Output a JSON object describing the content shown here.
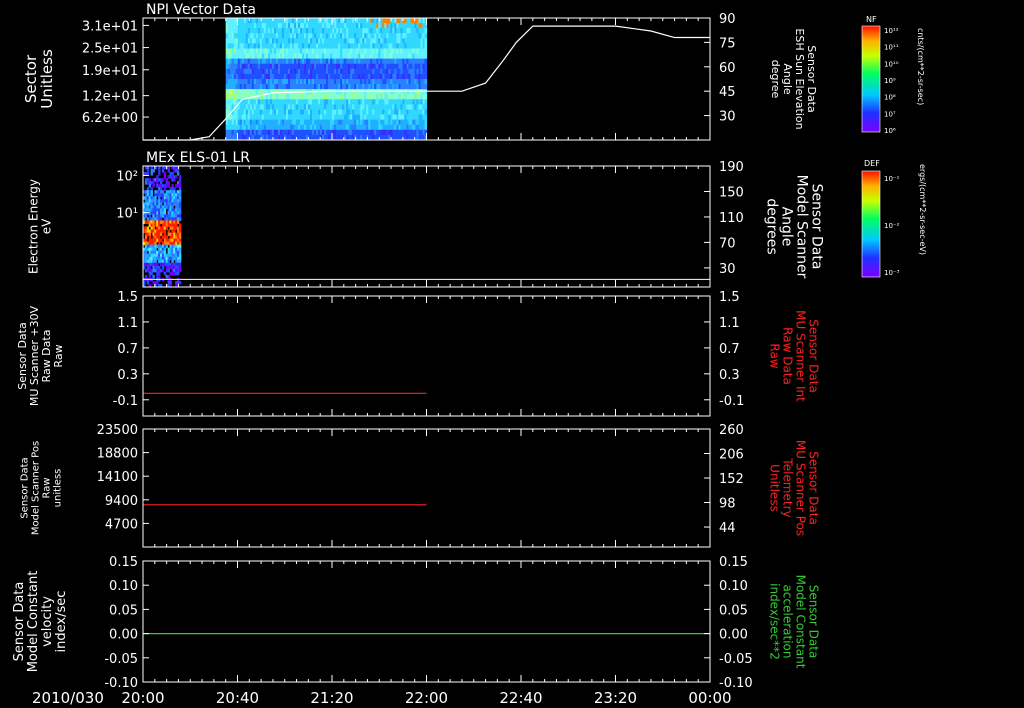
{
  "colors": {
    "background": "#000000",
    "axis": "#ffffff",
    "red_trace": "#ff2020",
    "green_trace": "#33cc33"
  },
  "time_axis": {
    "date_label": "2010/030",
    "start": "20:00",
    "end": "00:00",
    "tick_labels": [
      "20:00",
      "20:40",
      "21:20",
      "22:00",
      "22:40",
      "23:20",
      "00:00"
    ],
    "tick_minutes": [
      0,
      40,
      80,
      120,
      160,
      200,
      240
    ],
    "minor_tick_step_minutes": 5,
    "total_minutes": 240
  },
  "chart_data": [
    {
      "type": "heatmap",
      "title": "NPI Vector Data",
      "ylabel": [
        "Sector",
        "Unitless"
      ],
      "y_ticks": [
        "3.1e+01",
        "2.5e+01",
        "1.9e+01",
        "1.2e+01",
        "6.2e+00"
      ],
      "y_tick_values": [
        31,
        25,
        19,
        12,
        6.2
      ],
      "ylim": [
        0,
        33
      ],
      "data_extent_minutes": [
        35,
        120
      ],
      "colorbar": {
        "label": "NF",
        "units": "cnts/(cm**2-sr-sec)",
        "tick_labels": [
          "10¹²",
          "10¹¹",
          "10¹⁰",
          "10⁹",
          "10⁸",
          "10⁷",
          "10⁶"
        ]
      },
      "right_axis": {
        "label": [
          "Sensor Data",
          "ESH Sun Elevation",
          "Angle",
          "degree"
        ],
        "ticks": [
          "90",
          "75",
          "60",
          "45",
          "30"
        ],
        "tick_values": [
          90,
          75,
          60,
          45,
          30
        ],
        "ylim": [
          15,
          90
        ]
      },
      "overlay": {
        "name": "ESH Sun Elevation Angle",
        "x_minutes": [
          0,
          20,
          28,
          35,
          42,
          55,
          80,
          110,
          135,
          145,
          152,
          158,
          165,
          200,
          215,
          225,
          240
        ],
        "y": [
          15,
          15,
          17,
          28,
          40,
          44,
          45,
          45,
          45,
          50,
          63,
          75,
          85,
          85,
          82,
          78,
          78
        ]
      }
    },
    {
      "type": "heatmap",
      "title": "MEx ELS-01 LR",
      "ylabel": [
        "Electron Energy",
        "eV"
      ],
      "y_ticks": [
        "10²",
        "10¹"
      ],
      "y_tick_values": [
        100,
        10
      ],
      "ylim_log": [
        0.1,
        180
      ],
      "data_extent_minutes": [
        0,
        16
      ],
      "colorbar": {
        "label": "DEF",
        "units": "ergs/(cm**2-sr-sec-eV)",
        "tick_labels": [
          "10⁻¹",
          "10⁻²",
          "10⁻³"
        ]
      },
      "right_axis": {
        "label": [
          "Sensor Data",
          "Model Scanner",
          "Angle",
          "degrees"
        ],
        "ticks": [
          "190",
          "150",
          "110",
          "70",
          "30"
        ],
        "tick_values": [
          190,
          150,
          110,
          70,
          30
        ],
        "ylim": [
          0,
          190
        ]
      },
      "overlay": {
        "name": "Model Scanner Angle",
        "x_minutes": [
          0,
          240
        ],
        "y": [
          12,
          12
        ]
      }
    },
    {
      "type": "line",
      "ylabel": [
        "Sensor Data",
        "MU Scanner +30V",
        "Raw Data",
        "Raw"
      ],
      "y_ticks": [
        "1.5",
        "1.1",
        "0.7",
        "0.3",
        "-0.1"
      ],
      "y_tick_values": [
        1.5,
        1.1,
        0.7,
        0.3,
        -0.1
      ],
      "ylim": [
        -0.35,
        1.5
      ],
      "right_axis": {
        "label": [
          "Sensor Data",
          "MU Scanner Int",
          "Raw Data",
          "Raw"
        ],
        "ticks": [
          "1.5",
          "1.1",
          "0.7",
          "0.3",
          "-0.1"
        ],
        "tick_values": [
          1.5,
          1.1,
          0.7,
          0.3,
          -0.1
        ],
        "ylim": [
          -0.35,
          1.5
        ]
      },
      "series": [
        {
          "x_minutes": [
            0,
            120
          ],
          "y": [
            0.0,
            0.0
          ]
        }
      ]
    },
    {
      "type": "line",
      "ylabel": [
        "Sensor Data",
        "Model Scanner Pos",
        "Raw",
        "unitless"
      ],
      "y_ticks": [
        "23500",
        "18800",
        "14100",
        "9400",
        "4700"
      ],
      "y_tick_values": [
        23500,
        18800,
        14100,
        9400,
        4700
      ],
      "ylim": [
        0,
        23500
      ],
      "right_axis": {
        "label": [
          "Sensor Data",
          "MU Scanner Pos",
          "Telemetry",
          "Unitless"
        ],
        "ticks": [
          "260",
          "206",
          "152",
          "98",
          "44"
        ],
        "tick_values": [
          260,
          206,
          152,
          98,
          44
        ],
        "ylim": [
          0,
          260
        ]
      },
      "series": [
        {
          "x_minutes": [
            0,
            120
          ],
          "y": [
            8400,
            8400
          ]
        }
      ]
    },
    {
      "type": "line",
      "ylabel": [
        "Sensor Data",
        "Model Constant",
        "velocity",
        "index/sec"
      ],
      "y_ticks": [
        "0.15",
        "0.10",
        "0.05",
        "0.00",
        "-0.05",
        "-0.10"
      ],
      "y_tick_values": [
        0.15,
        0.1,
        0.05,
        0.0,
        -0.05,
        -0.1
      ],
      "ylim": [
        -0.1,
        0.15
      ],
      "right_axis": {
        "label": [
          "Sensor Data",
          "Model Constant",
          "acceleration",
          "index/sec**2"
        ],
        "ticks": [
          "0.15",
          "0.10",
          "0.05",
          "0.00",
          "-0.05",
          "-0.10"
        ],
        "tick_values": [
          0.15,
          0.1,
          0.05,
          0.0,
          -0.05,
          -0.1
        ],
        "ylim": [
          -0.1,
          0.15
        ]
      },
      "series": [
        {
          "x_minutes": [
            0,
            240
          ],
          "y": [
            0.0,
            0.0
          ]
        }
      ]
    }
  ]
}
